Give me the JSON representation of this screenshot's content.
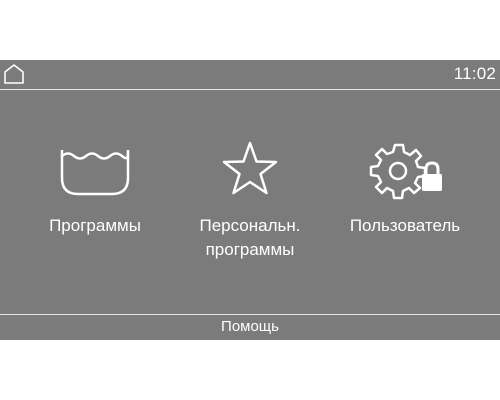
{
  "header": {
    "home_icon": "home-icon",
    "time": "11:02"
  },
  "menu": {
    "items": [
      {
        "icon": "washing-tub-icon",
        "label": "Программы"
      },
      {
        "icon": "star-icon",
        "label": "Персональн.\nпрограммы"
      },
      {
        "icon": "gear-lock-icon",
        "label": "Пользователь"
      }
    ]
  },
  "footer": {
    "help_label": "Помощь"
  },
  "colors": {
    "screen_background": "#7b7b7b",
    "foreground": "#ffffff",
    "page_background": "#ffffff"
  }
}
